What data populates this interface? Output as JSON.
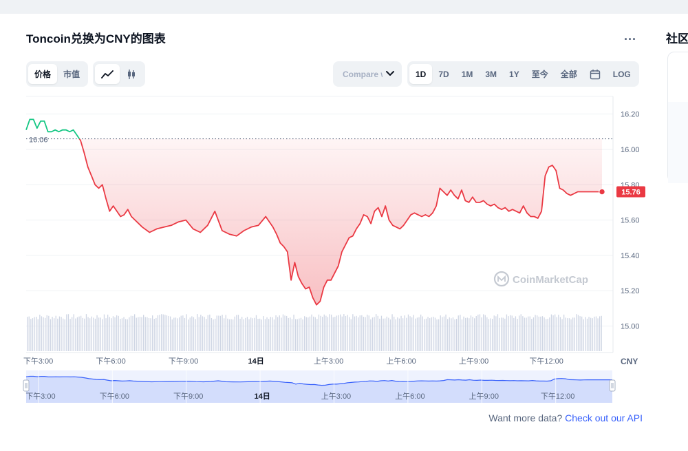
{
  "title": "Toncoin兑换为CNY的图表",
  "more_label": "...",
  "side_title": "社区",
  "view_tabs": [
    {
      "label": "价格",
      "active": true
    },
    {
      "label": "市值",
      "active": false
    }
  ],
  "type_tabs": [
    {
      "icon": "line-chart-icon",
      "active": true
    },
    {
      "icon": "candlestick-icon",
      "active": false
    }
  ],
  "compare": {
    "label": "Compare with"
  },
  "range_tabs": [
    {
      "label": "1D",
      "active": true
    },
    {
      "label": "7D",
      "active": false
    },
    {
      "label": "1M",
      "active": false
    },
    {
      "label": "3M",
      "active": false
    },
    {
      "label": "1Y",
      "active": false
    },
    {
      "label": "至今",
      "active": false
    },
    {
      "label": "全部",
      "active": false
    }
  ],
  "calendar_icon": "calendar-icon",
  "log_label": "LOG",
  "watermark": "CoinMarketCap",
  "footer": {
    "prefix": "Want more data?",
    "link": "Check out our API"
  },
  "colors": {
    "down": "#ea3943",
    "up": "#16c784",
    "navigator": "#3861fb",
    "text_muted": "#58667e"
  },
  "chart_data": {
    "type": "line",
    "ylabel": "CNY",
    "ylim": [
      14.85,
      16.3
    ],
    "yticks": [
      15.0,
      15.2,
      15.4,
      15.6,
      15.8,
      16.0,
      16.2
    ],
    "ytick_labels": [
      "15.00",
      "15.20",
      "15.40",
      "15.60",
      "15.80",
      "16.00",
      "16.20"
    ],
    "x_labels": [
      "下午3:00",
      "下午6:00",
      "下午9:00",
      "14日",
      "上午3:00",
      "上午6:00",
      "上午9:00",
      "下午12:00"
    ],
    "x_label_bold": [
      false,
      false,
      false,
      true,
      false,
      false,
      false,
      false
    ],
    "x_label_t": [
      0.5,
      3.5,
      6.5,
      9.5,
      12.5,
      15.5,
      18.5,
      21.5
    ],
    "x_range_hours": [
      0,
      23.8
    ],
    "reference_value": 16.06,
    "reference_label": "16.06",
    "current_value": 15.76,
    "current_label": "15.76",
    "navigator_labels": [
      "下午3:00",
      "下午6:00",
      "下午9:00",
      "14日",
      "上午3:00",
      "上午6:00",
      "上午9:00",
      "下午12:00"
    ],
    "series": [
      {
        "t": [
          0,
          0.15,
          0.3,
          0.45,
          0.6,
          0.75,
          0.9,
          1.05,
          1.2,
          1.35,
          1.5,
          1.65,
          1.8,
          1.95,
          2.1,
          2.25,
          2.4,
          2.55,
          2.7,
          2.85,
          3.0,
          3.15,
          3.3,
          3.45,
          3.6,
          3.75,
          3.9,
          4.05,
          4.2,
          4.35,
          4.5,
          4.8,
          5.1,
          5.4,
          5.7,
          6.0,
          6.3,
          6.6,
          6.9,
          7.2,
          7.5,
          7.8,
          8.1,
          8.4,
          8.7,
          9.0,
          9.3,
          9.6,
          9.9,
          10.2,
          10.35,
          10.5,
          10.65,
          10.8,
          10.95,
          11.1,
          11.25,
          11.4,
          11.55,
          11.7,
          11.85,
          12.0,
          12.15,
          12.3,
          12.45,
          12.6,
          12.75,
          12.9,
          13.05,
          13.2,
          13.35,
          13.5,
          13.65,
          13.8,
          13.95,
          14.1,
          14.25,
          14.4,
          14.55,
          14.7,
          14.85,
          15.0,
          15.15,
          15.3,
          15.45,
          15.6,
          15.75,
          15.9,
          16.05,
          16.2,
          16.35,
          16.5,
          16.65,
          16.8,
          16.95,
          17.1,
          17.25,
          17.4,
          17.55,
          17.7,
          17.85,
          18.0,
          18.15,
          18.3,
          18.45,
          18.6,
          18.75,
          18.9,
          19.05,
          19.2,
          19.35,
          19.5,
          19.65,
          19.8,
          19.95,
          20.1,
          20.25,
          20.4,
          20.55,
          20.7,
          20.85,
          21.0,
          21.15,
          21.3,
          21.45,
          21.6,
          21.75,
          21.9,
          22.05,
          22.2,
          22.35,
          22.5,
          22.65,
          22.8,
          22.95,
          23.1,
          23.25,
          23.4,
          23.55,
          23.7,
          23.8
        ],
        "values": [
          16.11,
          16.17,
          16.17,
          16.12,
          16.16,
          16.16,
          16.1,
          16.1,
          16.11,
          16.1,
          16.11,
          16.11,
          16.1,
          16.11,
          16.08,
          16.05,
          15.98,
          15.9,
          15.85,
          15.8,
          15.78,
          15.8,
          15.72,
          15.65,
          15.68,
          15.65,
          15.62,
          15.63,
          15.66,
          15.62,
          15.6,
          15.56,
          15.53,
          15.55,
          15.56,
          15.57,
          15.59,
          15.6,
          15.55,
          15.53,
          15.57,
          15.65,
          15.54,
          15.52,
          15.51,
          15.54,
          15.56,
          15.57,
          15.62,
          15.56,
          15.52,
          15.47,
          15.45,
          15.42,
          15.26,
          15.36,
          15.28,
          15.24,
          15.21,
          15.22,
          15.16,
          15.12,
          15.14,
          15.22,
          15.26,
          15.26,
          15.3,
          15.34,
          15.42,
          15.46,
          15.5,
          15.51,
          15.55,
          15.58,
          15.63,
          15.62,
          15.58,
          15.65,
          15.67,
          15.62,
          15.68,
          15.6,
          15.57,
          15.56,
          15.55,
          15.57,
          15.6,
          15.63,
          15.64,
          15.63,
          15.62,
          15.63,
          15.62,
          15.64,
          15.68,
          15.78,
          15.76,
          15.74,
          15.77,
          15.74,
          15.72,
          15.77,
          15.71,
          15.7,
          15.73,
          15.7,
          15.7,
          15.71,
          15.69,
          15.68,
          15.69,
          15.67,
          15.66,
          15.67,
          15.65,
          15.66,
          15.65,
          15.64,
          15.68,
          15.64,
          15.62,
          15.62,
          15.61,
          15.65,
          15.85,
          15.9,
          15.91,
          15.88,
          15.78,
          15.77,
          15.75,
          15.74,
          15.75,
          15.76,
          15.76,
          15.76,
          15.76,
          15.76,
          15.76,
          15.76,
          15.76
        ]
      }
    ]
  }
}
